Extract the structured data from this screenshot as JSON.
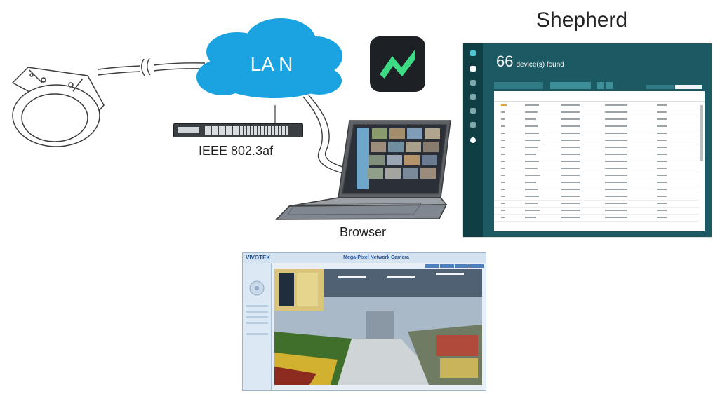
{
  "labels": {
    "cloud": "LA N",
    "switch_caption": "IEEE 802.3af",
    "browser_caption": "Browser",
    "shepherd_caption": "Shepherd"
  },
  "shepherd": {
    "device_count": "66",
    "device_count_suffix": "device(s) found"
  },
  "browser_screenshot": {
    "brand": "VIVOTEK",
    "title": "Mega-Pixel Network Camera"
  },
  "colors": {
    "cloud": "#1aa3e0",
    "app_icon_bg": "#1d2126",
    "app_icon_mark": "#3ddc84",
    "shepherd_bg": "#1b5a63",
    "connector": "#3c3c3c"
  },
  "icons": [
    "dome-camera-icon",
    "cloud-icon",
    "network-switch-icon",
    "app-icon",
    "laptop-icon"
  ]
}
